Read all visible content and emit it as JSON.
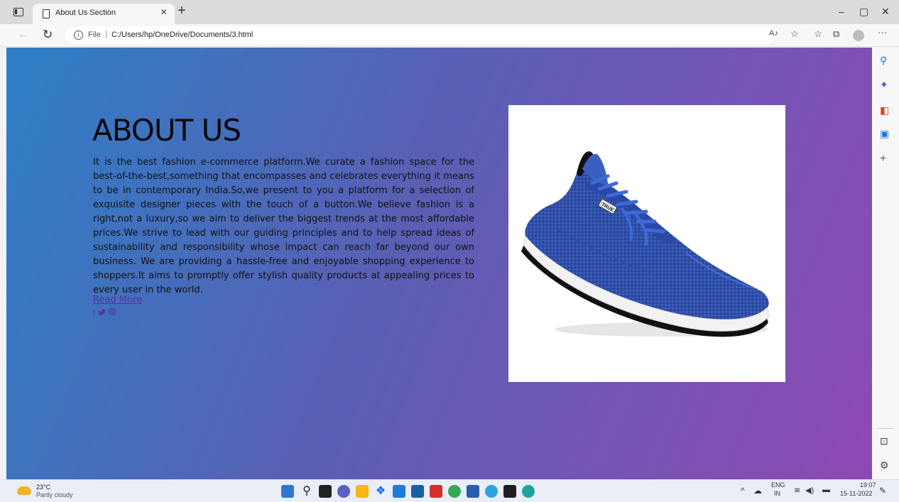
{
  "browser": {
    "tab_title": "About Us Section",
    "url_scheme": "File",
    "url": "C:/Users/hp/OneDrive/Documents/3.html"
  },
  "page": {
    "heading": "ABOUT US",
    "paragraph": "It is the best fashion e-commerce platform.We curate a fashion space for the best-of-the-best,something that encompasses and celebrates everything it means to be in contemporary India.So,we present to you a platform for a selection of exquisite designer pieces with the touch of a button.We believe fashion is a right,not a luxury,so we aim to deliver the biggest trends at the most affordable prices.We strive to lead with our guiding principles and to help spread ideas of sustainability and responsibility whose impact can reach far beyond our own business. We are providing a hassle-free and enjoyable shopping experience to shoppers.It aims to promptly offer stylish quality products at appealing prices to every user in the world.",
    "read_more": "Read More",
    "social_icons": [
      "facebook-icon",
      "twitter-icon",
      "instagram-icon"
    ],
    "shoe_tag": "TRUE"
  },
  "taskbar": {
    "temperature": "23°C",
    "weather": "Partly cloudy",
    "lang_top": "ENG",
    "lang_bottom": "IN",
    "time": "19:07",
    "date": "15-11-2022"
  },
  "colors": {
    "gradient_start": "#2d7fc6",
    "gradient_end": "#8e49b3",
    "link": "#5e2da0"
  }
}
